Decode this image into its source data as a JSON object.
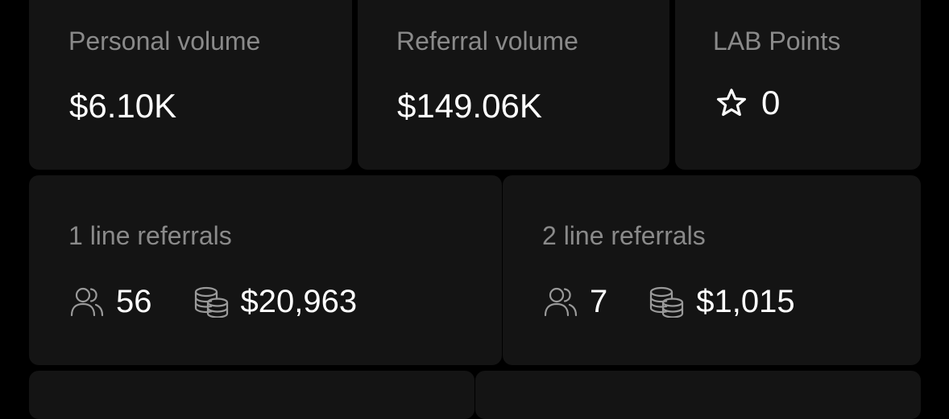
{
  "cards": {
    "personal_volume": {
      "label": "Personal volume",
      "value": "$6.10K"
    },
    "referral_volume": {
      "label": "Referral volume",
      "value": "$149.06K"
    },
    "lab_points": {
      "label": "LAB Points",
      "value": "0",
      "icon": "star-icon"
    }
  },
  "referrals": {
    "line1": {
      "label": "1 line referrals",
      "users_icon": "users-icon",
      "users_count": "56",
      "coins_icon": "coins-icon",
      "amount": "$20,963"
    },
    "line2": {
      "label": "2 line referrals",
      "users_icon": "users-icon",
      "users_count": "7",
      "coins_icon": "coins-icon",
      "amount": "$1,015"
    }
  },
  "colors": {
    "background": "#000000",
    "card": "#141414",
    "label": "#8a8a8a",
    "value": "#ffffff",
    "icon": "#9a9a9a"
  }
}
